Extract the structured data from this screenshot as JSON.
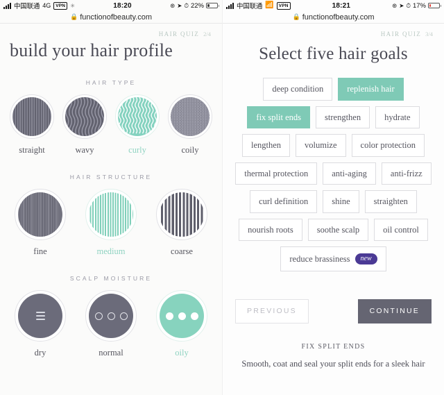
{
  "left": {
    "status": {
      "signal_icon": "signal-bars-icon",
      "carrier": "中国联通",
      "network": "4G",
      "vpn": "VPN",
      "spinner_icon": "activity-spinner-icon",
      "time": "18:20",
      "orientation_icon": "orientation-lock-icon",
      "location_icon": "location-arrow-icon",
      "alarm_icon": "alarm-clock-icon",
      "battery_pct": "22%",
      "battery_level": 22,
      "battery_color": "#3c3c3c"
    },
    "url": {
      "lock_icon": "padlock-icon",
      "domain": "functionofbeauty.com"
    },
    "quiz": {
      "label": "HAIR QUIZ",
      "step": "2/4"
    },
    "title": "build your hair profile",
    "sections": [
      {
        "title": "HAIR TYPE",
        "options": [
          {
            "label": "straight",
            "texture": "straight",
            "selected": false
          },
          {
            "label": "wavy",
            "texture": "wavy",
            "selected": false
          },
          {
            "label": "curly",
            "texture": "curly",
            "selected": true
          },
          {
            "label": "coily",
            "texture": "coily",
            "selected": false
          }
        ]
      },
      {
        "title": "HAIR STRUCTURE",
        "options": [
          {
            "label": "fine",
            "texture": "fine",
            "selected": false
          },
          {
            "label": "medium",
            "texture": "medium",
            "selected": true
          },
          {
            "label": "coarse",
            "texture": "coarse",
            "selected": false
          }
        ]
      },
      {
        "title": "SCALP MOISTURE",
        "options": [
          {
            "label": "dry",
            "texture": "lines",
            "selected": false
          },
          {
            "label": "normal",
            "texture": "circles",
            "selected": false
          },
          {
            "label": "oily",
            "texture": "dots",
            "selected": true
          }
        ]
      }
    ]
  },
  "right": {
    "status": {
      "signal_icon": "signal-bars-icon",
      "carrier": "中国联通",
      "wifi_icon": "wifi-icon",
      "vpn": "VPN",
      "time": "18:21",
      "orientation_icon": "orientation-lock-icon",
      "location_icon": "location-arrow-icon",
      "alarm_icon": "alarm-clock-icon",
      "battery_pct": "17%",
      "battery_level": 17,
      "battery_color": "#e23b32"
    },
    "url": {
      "lock_icon": "padlock-icon",
      "domain": "functionofbeauty.com"
    },
    "quiz": {
      "label": "HAIR QUIZ",
      "step": "3/4"
    },
    "title": "Select five hair goals",
    "goal_rows": [
      [
        {
          "label": "deep condition",
          "selected": false
        },
        {
          "label": "replenish hair",
          "selected": true
        }
      ],
      [
        {
          "label": "fix split ends",
          "selected": true
        },
        {
          "label": "strengthen",
          "selected": false
        },
        {
          "label": "hydrate",
          "selected": false
        }
      ],
      [
        {
          "label": "lengthen",
          "selected": false
        },
        {
          "label": "volumize",
          "selected": false
        },
        {
          "label": "color protection",
          "selected": false
        }
      ],
      [
        {
          "label": "thermal protection",
          "selected": false
        },
        {
          "label": "anti-aging",
          "selected": false
        },
        {
          "label": "anti-frizz",
          "selected": false
        }
      ],
      [
        {
          "label": "curl definition",
          "selected": false
        },
        {
          "label": "shine",
          "selected": false
        },
        {
          "label": "straighten",
          "selected": false
        }
      ],
      [
        {
          "label": "nourish roots",
          "selected": false
        },
        {
          "label": "soothe scalp",
          "selected": false
        },
        {
          "label": "oil control",
          "selected": false
        }
      ],
      [
        {
          "label": "reduce brassiness",
          "selected": false,
          "badge": "new"
        }
      ]
    ],
    "nav": {
      "previous": "PREVIOUS",
      "continue": "CONTINUE"
    },
    "footnote": {
      "title": "FIX SPLIT ENDS",
      "body": "Smooth, coat and seal your split ends for a sleek hair"
    }
  },
  "colors": {
    "mint": "#7fcab6",
    "slate": "#6b6b7a",
    "purple_badge": "#4b3a95",
    "text": "#4a4a55"
  }
}
